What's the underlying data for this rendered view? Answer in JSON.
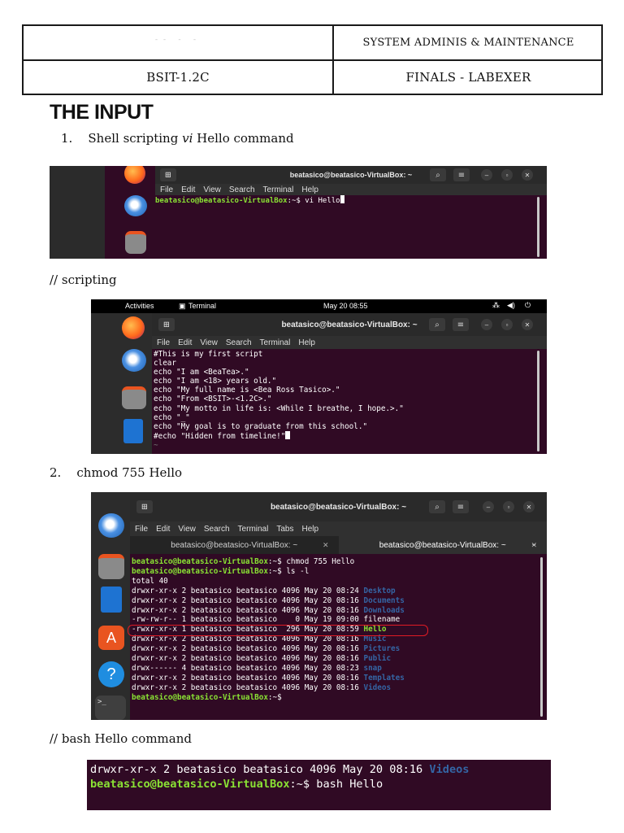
{
  "header": {
    "name_faint": "ˉˉ  ˉ  ˉ",
    "course": "SYSTEM ADMINIS & MAINTENANCE",
    "section": "BSIT-1.2C",
    "exam": "FINALS - LABEXER"
  },
  "title": "THE INPUT",
  "item1": {
    "num": "1.",
    "pre": "Shell scripting ",
    "em": "vi",
    "post": " Hello command"
  },
  "note_scripting": "// scripting",
  "item2": {
    "num": "2.",
    "text": "chmod 755 Hello"
  },
  "note_bash": "// bash Hello command",
  "term1": {
    "title": "beatasico@beatasico-VirtualBox: ~",
    "menu": [
      "File",
      "Edit",
      "View",
      "Search",
      "Terminal",
      "Help"
    ],
    "prompt": "beatasico@beatasico-VirtualBox",
    "path": ":~$ ",
    "cmd": "vi Hello"
  },
  "term2": {
    "activities": "Activities",
    "app": "Terminal",
    "clock": "May 20  08:55",
    "title": "beatasico@beatasico-VirtualBox: ~",
    "menu": [
      "File",
      "Edit",
      "View",
      "Search",
      "Terminal",
      "Help"
    ],
    "lines": [
      "#This is my first script",
      "clear",
      "echo \"I am <BeaTea>.\"",
      "echo \"I am <18> years old.\"",
      "echo \"My full name is <Bea Ross Tasico>.\"",
      "echo \"From <BSIT>-<1.2C>.\"",
      "echo \"My motto in life is: <While I breathe, I hope.>.\"",
      "echo \"_\"",
      "echo \"My goal is to graduate from this school.\"",
      "#echo \"Hidden from timeline!\""
    ],
    "tilde": "~"
  },
  "term3": {
    "title": "beatasico@beatasico-VirtualBox: ~",
    "menu": [
      "File",
      "Edit",
      "View",
      "Search",
      "Terminal",
      "Tabs",
      "Help"
    ],
    "tabs": [
      "beatasico@beatasico-VirtualBox: ~",
      "beatasico@beatasico-VirtualBox: ~"
    ],
    "prompt": "beatasico@beatasico-VirtualBox",
    "path": ":~$ ",
    "cmd1": "chmod 755 Hello",
    "cmd2": "ls -l",
    "total": "total 40",
    "listing": [
      {
        "perm": "drwxr-xr-x 2 beatasico beatasico 4096 May 20 08:24 ",
        "name": "Desktop",
        "kind": "dir"
      },
      {
        "perm": "drwxr-xr-x 2 beatasico beatasico 4096 May 20 08:16 ",
        "name": "Documents",
        "kind": "dir"
      },
      {
        "perm": "drwxr-xr-x 2 beatasico beatasico 4096 May 20 08:16 ",
        "name": "Downloads",
        "kind": "dir"
      },
      {
        "perm": "-rw-rw-r-- 1 beatasico beatasico    0 May 19 09:00 ",
        "name": "filename",
        "kind": "file"
      },
      {
        "perm": "-rwxr-xr-x 1 beatasico beatasico  296 May 20 08:59 ",
        "name": "Hello",
        "kind": "exec"
      },
      {
        "perm": "drwxr-xr-x 2 beatasico beatasico 4096 May 20 08:16 ",
        "name": "Music",
        "kind": "dir"
      },
      {
        "perm": "drwxr-xr-x 2 beatasico beatasico 4096 May 20 08:16 ",
        "name": "Pictures",
        "kind": "dir"
      },
      {
        "perm": "drwxr-xr-x 2 beatasico beatasico 4096 May 20 08:16 ",
        "name": "Public",
        "kind": "dir"
      },
      {
        "perm": "drwx------ 4 beatasico beatasico 4096 May 20 08:23 ",
        "name": "snap",
        "kind": "dir"
      },
      {
        "perm": "drwxr-xr-x 2 beatasico beatasico 4096 May 20 08:16 ",
        "name": "Templates",
        "kind": "dir"
      },
      {
        "perm": "drwxr-xr-x 2 beatasico beatasico 4096 May 20 08:16 ",
        "name": "Videos",
        "kind": "dir"
      }
    ]
  },
  "term4": {
    "line1_perm": "drwxr-xr-x 2 beatasico beatasico 4096 May 20 08:16 ",
    "line1_name": "Videos",
    "prompt": "beatasico@beatasico-VirtualBox",
    "path": ":~$ ",
    "cmd": "bash Hello"
  },
  "colors": {
    "terminal_bg": "#300a24",
    "prompt_green": "#8ae234",
    "dir_blue": "#3465a4",
    "highlight_red": "#e01b24"
  }
}
